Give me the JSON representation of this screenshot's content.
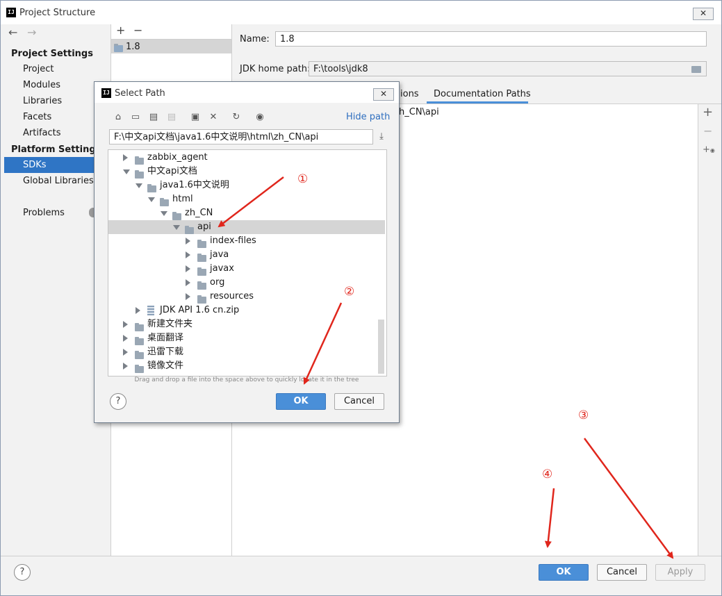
{
  "window": {
    "title": "Project Structure",
    "close": "✕"
  },
  "nav": {
    "back": "←",
    "forward": "→",
    "project_settings": "Project Settings",
    "project_items": [
      "Project",
      "Modules",
      "Libraries",
      "Facets",
      "Artifacts"
    ],
    "platform_settings": "Platform Settings",
    "platform_items": [
      "SDKs",
      "Global Libraries"
    ],
    "problems": "Problems",
    "selected": "SDKs"
  },
  "sdk_list": {
    "add": "+",
    "remove": "−",
    "items": [
      "1.8"
    ]
  },
  "sdk_detail": {
    "name_label": "Name:",
    "name_value": "1.8",
    "home_label": "JDK home path:",
    "home_value": "F:\\tools\\jdk8",
    "tab_partial": "ions",
    "tab_active": "Documentation Paths",
    "path_fragment": "h_CN\\api",
    "side_add": "+",
    "side_remove": "−"
  },
  "dialog": {
    "title": "Select Path",
    "close": "✕",
    "hide_path": "Hide path",
    "path": "F:\\中文api文档\\java1.6中文说明\\html\\zh_CN\\api",
    "tree": [
      {
        "label": "zabbix_agent",
        "depth": 0,
        "state": "collapsed",
        "kind": "folder"
      },
      {
        "label": "中文api文档",
        "depth": 0,
        "state": "expanded",
        "kind": "folder"
      },
      {
        "label": "java1.6中文说明",
        "depth": 1,
        "state": "expanded",
        "kind": "folder"
      },
      {
        "label": "html",
        "depth": 2,
        "state": "expanded",
        "kind": "folder"
      },
      {
        "label": "zh_CN",
        "depth": 3,
        "state": "expanded",
        "kind": "folder"
      },
      {
        "label": "api",
        "depth": 4,
        "state": "expanded",
        "kind": "folder",
        "selected": true
      },
      {
        "label": "index-files",
        "depth": 5,
        "state": "collapsed",
        "kind": "folder"
      },
      {
        "label": "java",
        "depth": 5,
        "state": "collapsed",
        "kind": "folder"
      },
      {
        "label": "javax",
        "depth": 5,
        "state": "collapsed",
        "kind": "folder"
      },
      {
        "label": "org",
        "depth": 5,
        "state": "collapsed",
        "kind": "folder"
      },
      {
        "label": "resources",
        "depth": 5,
        "state": "collapsed",
        "kind": "folder"
      },
      {
        "label": "JDK API 1.6 cn.zip",
        "depth": 1,
        "state": "collapsed",
        "kind": "zip"
      },
      {
        "label": "新建文件夹",
        "depth": 0,
        "state": "collapsed",
        "kind": "folder"
      },
      {
        "label": "桌面翻译",
        "depth": 0,
        "state": "collapsed",
        "kind": "folder"
      },
      {
        "label": "迅雷下载",
        "depth": 0,
        "state": "collapsed",
        "kind": "folder"
      },
      {
        "label": "镜像文件",
        "depth": 0,
        "state": "collapsed",
        "kind": "folder"
      }
    ],
    "hint": "Drag and drop a file into the space above to quickly locate it in the tree",
    "help": "?",
    "ok": "OK",
    "cancel": "Cancel"
  },
  "annotations": {
    "one": "①",
    "two": "②",
    "three": "③",
    "four": "④",
    "color": "#e0261c"
  },
  "footer": {
    "help": "?",
    "ok": "OK",
    "cancel": "Cancel",
    "apply": "Apply"
  }
}
